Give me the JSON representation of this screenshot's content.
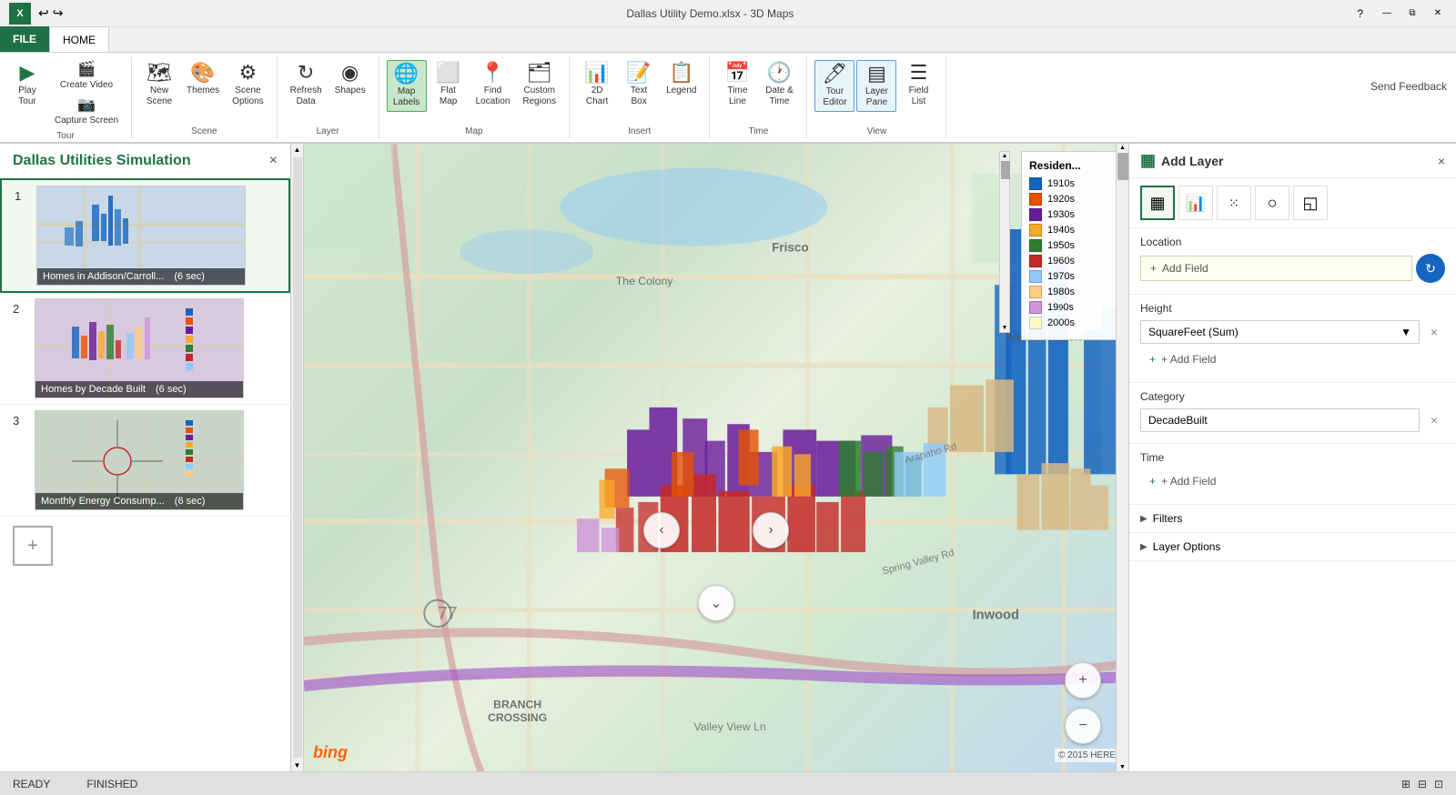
{
  "title_bar": {
    "title": "Dallas Utility Demo.xlsx - 3D Maps",
    "help_label": "?",
    "send_feedback": "Send Feedback"
  },
  "ribbon_tabs": {
    "file_label": "FILE",
    "home_label": "HOME"
  },
  "ribbon": {
    "groups": [
      {
        "name": "tour",
        "label": "Tour",
        "buttons": [
          {
            "id": "play-tour",
            "icon": "▶",
            "label": "Play\nTour"
          },
          {
            "id": "create-video",
            "icon": "🎬",
            "label": "Create\nVideo"
          },
          {
            "id": "capture-screen",
            "icon": "📷",
            "label": "Capture\nScreen"
          }
        ]
      },
      {
        "name": "scene",
        "label": "Scene",
        "buttons": [
          {
            "id": "new-scene",
            "icon": "🗺",
            "label": "New\nScene"
          },
          {
            "id": "themes",
            "icon": "🎨",
            "label": "Themes"
          },
          {
            "id": "scene-options",
            "icon": "⚙",
            "label": "Scene\nOptions"
          }
        ]
      },
      {
        "name": "layer",
        "label": "Layer",
        "buttons": [
          {
            "id": "refresh-data",
            "icon": "↻",
            "label": "Refresh\nData"
          },
          {
            "id": "shapes",
            "icon": "◉",
            "label": "Shapes"
          }
        ]
      },
      {
        "name": "map",
        "label": "Map",
        "buttons": [
          {
            "id": "map-labels",
            "icon": "🌐",
            "label": "Map\nLabels",
            "active": true
          },
          {
            "id": "flat-map",
            "icon": "⬜",
            "label": "Flat\nMap"
          },
          {
            "id": "find-location",
            "icon": "📍",
            "label": "Find\nLocation"
          },
          {
            "id": "custom-regions",
            "icon": "🗂",
            "label": "Custom\nRegions"
          }
        ]
      },
      {
        "name": "insert",
        "label": "Insert",
        "buttons": [
          {
            "id": "2d-chart",
            "icon": "📊",
            "label": "2D\nChart"
          },
          {
            "id": "text-box",
            "icon": "📝",
            "label": "Text\nBox"
          },
          {
            "id": "legend",
            "icon": "📋",
            "label": "Legend"
          }
        ]
      },
      {
        "name": "time",
        "label": "Time",
        "buttons": [
          {
            "id": "time-line",
            "icon": "📅",
            "label": "Time\nLine"
          },
          {
            "id": "date-time",
            "icon": "🕐",
            "label": "Date &\nTime"
          }
        ]
      },
      {
        "name": "view",
        "label": "View",
        "buttons": [
          {
            "id": "tour-editor",
            "icon": "🖊",
            "label": "Tour\nEditor",
            "highlighted": true
          },
          {
            "id": "layer-pane",
            "icon": "▤",
            "label": "Layer\nPane",
            "highlighted": true
          },
          {
            "id": "field-list",
            "icon": "☰",
            "label": "Field\nList"
          }
        ]
      }
    ]
  },
  "scene_panel": {
    "title": "Dallas Utilities Simulation",
    "close_label": "×",
    "scenes": [
      {
        "number": "1",
        "label": "Homes in Addison/Carroll...",
        "duration": "(6 sec)",
        "active": true
      },
      {
        "number": "2",
        "label": "Homes by Decade Built",
        "duration": "(6 sec)",
        "active": false
      },
      {
        "number": "3",
        "label": "Monthly Energy Consump...",
        "duration": "(6 sec)",
        "active": false
      }
    ],
    "add_scene_label": "+"
  },
  "map": {
    "bing_label": "bing",
    "copyright": "© 2015 HERE"
  },
  "legend": {
    "title": "Residen...",
    "items": [
      {
        "label": "1910s",
        "color": "#1565c0"
      },
      {
        "label": "1920s",
        "color": "#e65100"
      },
      {
        "label": "1930s",
        "color": "#6a1b9a"
      },
      {
        "label": "1940s",
        "color": "#f9a825"
      },
      {
        "label": "1950s",
        "color": "#2e7d32"
      },
      {
        "label": "1960s",
        "color": "#c62828"
      },
      {
        "label": "1970s",
        "color": "#90caf9"
      },
      {
        "label": "1980s",
        "color": "#ffcc80"
      },
      {
        "label": "1990s",
        "color": "#ce93d8"
      },
      {
        "label": "2000s",
        "color": "#fff9c4"
      }
    ]
  },
  "layer_panel": {
    "add_layer_label": "Add Layer",
    "close_label": "×",
    "layer_icons": [
      {
        "id": "bar-icon",
        "symbol": "▦",
        "active": true
      },
      {
        "id": "chart-icon",
        "symbol": "📊"
      },
      {
        "id": "scatter-icon",
        "symbol": "⁙"
      },
      {
        "id": "globe-icon",
        "symbol": "○"
      },
      {
        "id": "region-icon",
        "symbol": "◱"
      }
    ],
    "location": {
      "label": "Location",
      "add_field_label": "Add Field",
      "refresh_icon": "↻"
    },
    "height": {
      "label": "Height",
      "field_value": "SquareFeet (Sum)",
      "dropdown_icon": "▼",
      "clear_icon": "×",
      "add_field_label": "+ Add Field"
    },
    "category": {
      "label": "Category",
      "field_value": "DecadeBuilt",
      "clear_icon": "×"
    },
    "time": {
      "label": "Time",
      "add_field_label": "+ Add Field"
    },
    "filters": {
      "label": "Filters",
      "expand_icon": "▶"
    },
    "layer_options": {
      "label": "Layer Options",
      "expand_icon": "▶"
    }
  },
  "status_bar": {
    "ready_label": "READY",
    "finished_label": "FINISHED"
  }
}
